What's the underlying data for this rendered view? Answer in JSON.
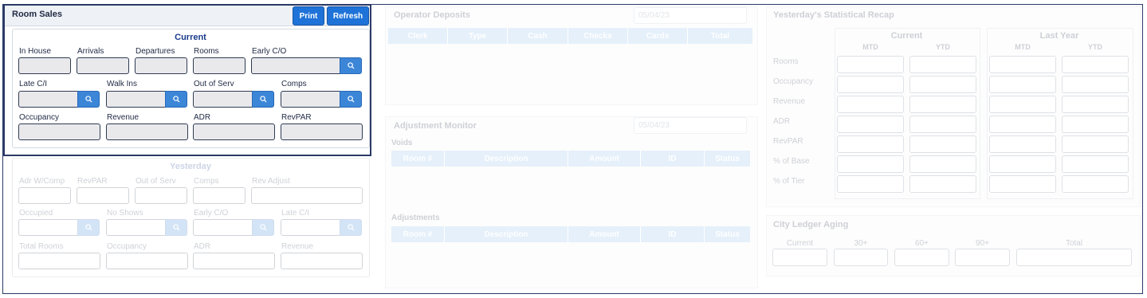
{
  "room_sales": {
    "title": "Room Sales",
    "print_label": "Print",
    "refresh_label": "Refresh",
    "current_heading": "Current",
    "row1": [
      "In House",
      "Arrivals",
      "Departures",
      "Rooms",
      "Early C/O"
    ],
    "row2": [
      "Late C/I",
      "Walk Ins",
      "Out of Serv",
      "Comps"
    ],
    "row3": [
      "Occupancy",
      "Revenue",
      "ADR",
      "RevPAR"
    ]
  },
  "yesterday": {
    "heading": "Yesterday",
    "row1": [
      "Adr W/Comp",
      "RevPAR",
      "Out of Serv",
      "Comps",
      "Rev Adjust"
    ],
    "row2": [
      "Occupied",
      "No Shows",
      "Early C/O",
      "Late C/I"
    ],
    "row3": [
      "Total Rooms",
      "Occupancy",
      "ADR",
      "Revenue"
    ]
  },
  "operator_deposits": {
    "title": "Operator Deposits",
    "date": "05/04/23",
    "columns": [
      "Clerk",
      "Type",
      "Cash",
      "Checks",
      "Cards",
      "Total"
    ]
  },
  "adjustment_monitor": {
    "title": "Adjustment Monitor",
    "date": "05/04/23",
    "voids_label": "Voids",
    "adjustments_label": "Adjustments",
    "columns": [
      "Room #",
      "Description",
      "Amount",
      "ID",
      "Status"
    ]
  },
  "stat_recap": {
    "title": "Yesterday's Statistical Recap",
    "current_heading": "Current",
    "last_year_heading": "Last Year",
    "mtd": "MTD",
    "ytd": "YTD",
    "rows": [
      "Rooms",
      "Occupancy",
      "Revenue",
      "ADR",
      "RevPAR",
      "% of Base",
      "% of Tier"
    ]
  },
  "city_ledger": {
    "title": "City Ledger Aging",
    "columns": [
      "Current",
      "30+",
      "60+",
      "90+",
      "Total"
    ]
  },
  "colors": {
    "accent": "#1f73d8",
    "header_blue": "#8ec0ec",
    "border_dark": "#2b3a67"
  },
  "icons": {
    "search": "search-icon"
  }
}
